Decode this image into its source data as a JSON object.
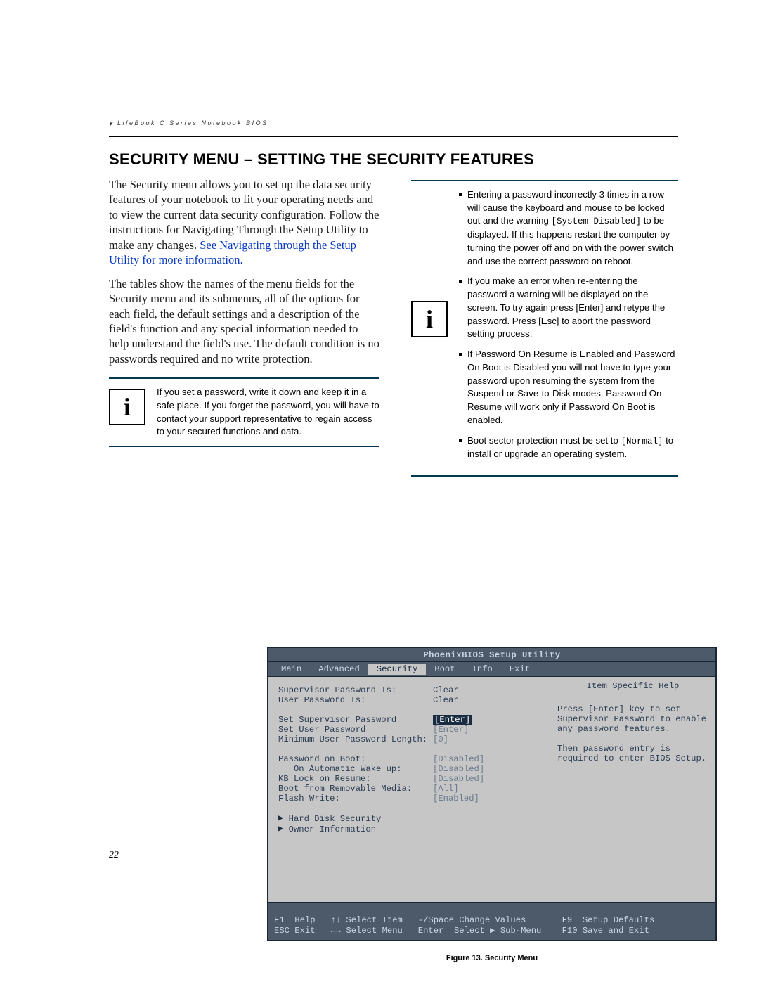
{
  "header": {
    "running_head": "LifeBook C Series Notebook BIOS"
  },
  "title": "SECURITY MENU – SETTING THE SECURITY FEATURES",
  "body": {
    "para1a": "The Security menu allows you to set up the data security features of your notebook to fit your operating needs and to view the current data security configuration. Follow the instructions for Navigating Through the Setup Utility to make any changes. ",
    "para1_link": "See Navigating through the Setup Utility for more information.",
    "para2": "The tables show the names of the menu fields for the Security menu and its submenus, all of the options for each field, the default settings and a description of the field's function and any special information needed to help understand the field's use. The default condition is no passwords required and no write protection."
  },
  "note_left": {
    "text": "If you set a password, write it down and keep it in a safe place. If you forget the password, you will have to contact your support representative to regain access to your secured functions and data."
  },
  "note_right": {
    "items": [
      {
        "pre": "Entering a password incorrectly 3 times in a row will cause the keyboard and mouse to be locked out and the warning ",
        "code": "[System Disabled]",
        "post": " to be displayed. If this happens restart the computer by turning the power off and on with the power switch and use the correct password on reboot."
      },
      {
        "pre": "If you make an error when re-entering the password a warning will be displayed on the screen. To try again press [Enter] and retype the password. Press [Esc] to abort the password setting process.",
        "code": "",
        "post": ""
      },
      {
        "pre": "If Password On Resume is Enabled and Password On Boot is Disabled you will not have to type your password upon resuming the system from the Suspend or Save-to-Disk modes. Password On Resume will work only if Password On Boot is enabled.",
        "code": "",
        "post": ""
      },
      {
        "pre": "Boot sector protection must be set to ",
        "code": "[Normal]",
        "post": " to install or upgrade an operating system."
      }
    ]
  },
  "bios": {
    "title": "PhoenixBIOS Setup Utility",
    "menu": [
      "Main",
      "Advanced",
      "Security",
      "Boot",
      "Info",
      "Exit"
    ],
    "active_menu_index": 2,
    "fields": [
      {
        "label": "Supervisor Password Is:",
        "value": "Clear",
        "style": "plain"
      },
      {
        "label": "User Password Is:",
        "value": "Clear",
        "style": "plain"
      },
      {
        "gap": true
      },
      {
        "label": "Set Supervisor Password",
        "value": "[Enter]",
        "style": "selected"
      },
      {
        "label": "Set User Password",
        "value": "[Enter]",
        "style": "dim"
      },
      {
        "label": "Minimum User Password Length:",
        "value": "[0]",
        "style": "dim"
      },
      {
        "gap": true
      },
      {
        "label": "Password on Boot:",
        "value": "[Disabled]",
        "style": "dim"
      },
      {
        "label": "   On Automatic Wake up:",
        "value": "[Disabled]",
        "style": "dim"
      },
      {
        "label": "KB Lock on Resume:",
        "value": "[Disabled]",
        "style": "dim"
      },
      {
        "label": "Boot from Removable Media:",
        "value": "[All]",
        "style": "dim"
      },
      {
        "label": "Flash Write:",
        "value": "[Enabled]",
        "style": "dim"
      },
      {
        "gap": true
      },
      {
        "submenu": true,
        "label": "Hard Disk Security"
      },
      {
        "submenu": true,
        "label": "Owner Information"
      }
    ],
    "help": {
      "title": "Item Specific Help",
      "text": "Press [Enter] key to set Supervisor Password to enable any password features.\n\nThen password entry is required to enter BIOS Setup."
    },
    "footer": {
      "l1": "F1  Help   ↑↓ Select Item   -/Space Change Values       F9  Setup Defaults",
      "l2": "ESC Exit   ←→ Select Menu   Enter  Select ▶ Sub-Menu    F10 Save and Exit"
    }
  },
  "figure_caption": "Figure 13.  Security Menu",
  "page_number": "22"
}
